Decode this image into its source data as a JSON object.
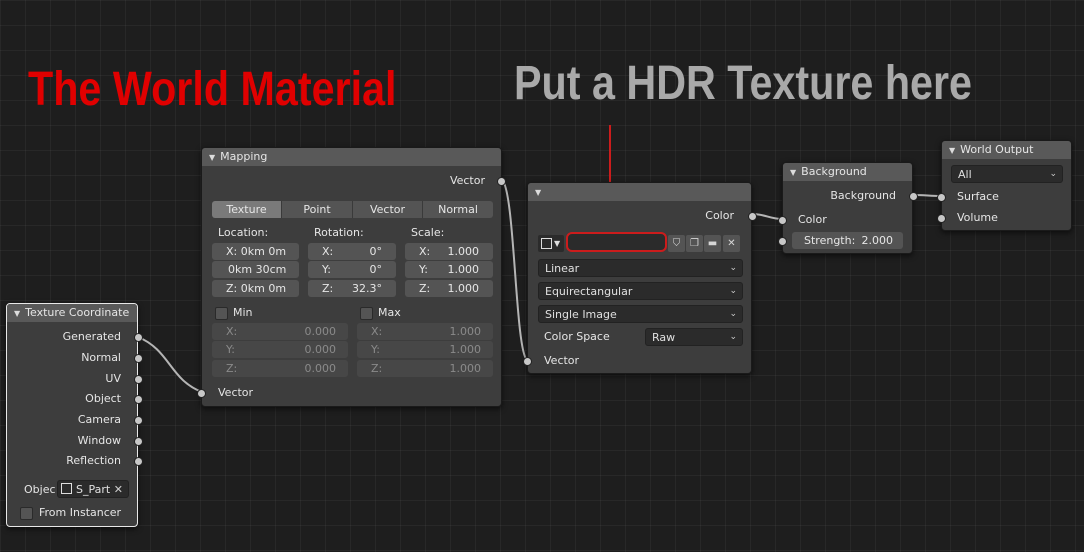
{
  "overlay": {
    "title_red": "The World Material",
    "title_gray": "Put a HDR Texture here"
  },
  "texture_coordinate": {
    "title": "Texture Coordinate",
    "outputs": [
      "Generated",
      "Normal",
      "UV",
      "Object",
      "Camera",
      "Window",
      "Reflection"
    ],
    "object_label": "Objec",
    "object_value": "S_Part",
    "from_instancer": "From Instancer"
  },
  "mapping": {
    "title": "Mapping",
    "output": "Vector",
    "tabs": [
      "Texture",
      "Point",
      "Vector",
      "Normal"
    ],
    "active_tab": "Texture",
    "location": {
      "label": "Location:",
      "x": "X:  0km 0m",
      "y": "0km 30cm",
      "z": "Z:  0km 0m"
    },
    "rotation": {
      "label": "Rotation:",
      "x_label": "X:",
      "x": "0°",
      "y_label": "Y:",
      "y": "0°",
      "z_label": "Z:",
      "z": "32.3°"
    },
    "scale": {
      "label": "Scale:",
      "x_label": "X:",
      "x": "1.000",
      "y_label": "Y:",
      "y": "1.000",
      "z_label": "Z:",
      "z": "1.000"
    },
    "min": {
      "label": "Min",
      "x_label": "X:",
      "x": "0.000",
      "y_label": "Y:",
      "y": "0.000",
      "z_label": "Z:",
      "z": "0.000"
    },
    "max": {
      "label": "Max",
      "x_label": "X:",
      "x": "1.000",
      "y_label": "Y:",
      "y": "1.000",
      "z_label": "Z:",
      "z": "1.000"
    },
    "input": "Vector"
  },
  "env_texture": {
    "output": "Color",
    "interpolation": "Linear",
    "projection": "Equirectangular",
    "source": "Single Image",
    "color_space_label": "Color Space",
    "color_space": "Raw",
    "input": "Vector"
  },
  "background": {
    "title": "Background",
    "output": "Background",
    "input_color": "Color",
    "strength_label": "Strength:",
    "strength": "2.000"
  },
  "world_output": {
    "title": "World Output",
    "target": "All",
    "inputs": [
      "Surface",
      "Volume"
    ]
  },
  "colors": {
    "title_red": "#e00000",
    "title_gray": "#a9a9a9",
    "highlight_red": "#cc1c1c",
    "node_body": "#3d3d3d",
    "node_header": "#595959",
    "socket": "#c7c7c7"
  }
}
